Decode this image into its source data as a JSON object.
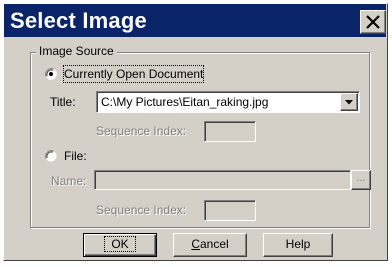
{
  "window": {
    "title": "Select Image",
    "close_icon": "close-icon"
  },
  "image_source": {
    "group_label": "Image Source",
    "option_current": {
      "label": "Currently Open Document",
      "selected": true
    },
    "title_label": "Title:",
    "title_value": "C:\\My Pictures\\Eitan_raking.jpg",
    "sequence_index_label_1": "Sequence Index:",
    "option_file": {
      "label": "File:",
      "selected": false
    },
    "name_label": "Name:",
    "name_value": "",
    "browse_label": "...",
    "sequence_index_label_2": "Sequence Index:"
  },
  "buttons": {
    "ok": "OK",
    "cancel_first": "C",
    "cancel_rest": "ancel",
    "help": "Help"
  },
  "colors": {
    "title_bar": "#0a246a",
    "face": "#d4d0c8"
  }
}
